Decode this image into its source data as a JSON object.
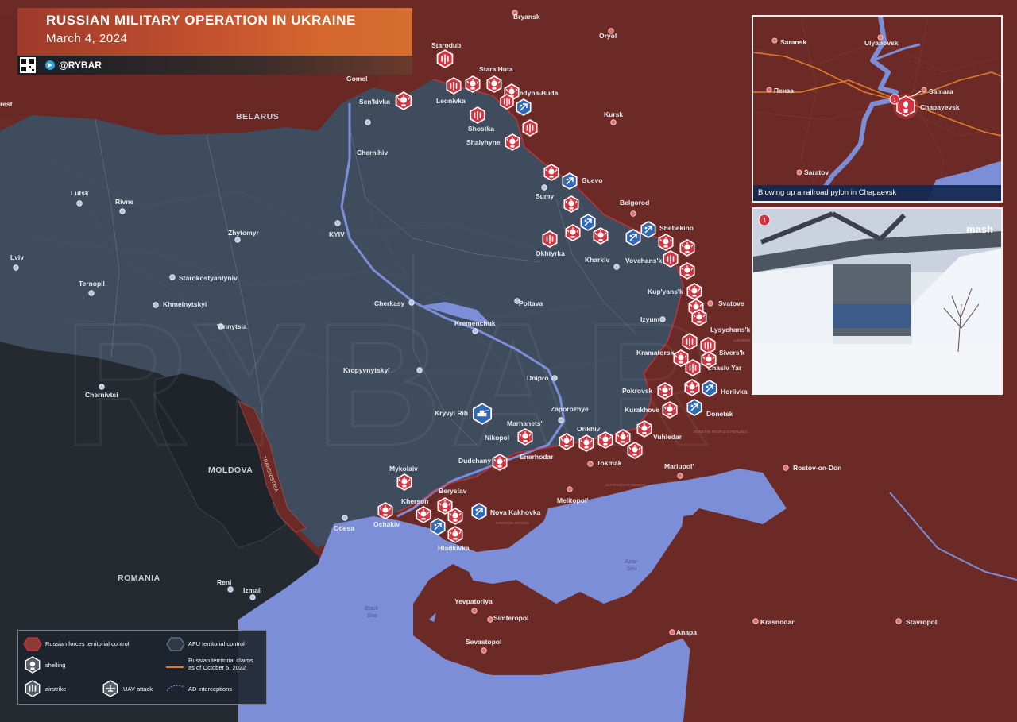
{
  "header": {
    "title": "RUSSIAN MILITARY OPERATION IN UKRAINE",
    "date": "March 4, 2024",
    "handle": "@RYBAR"
  },
  "colors": {
    "russia_control": "#6b2a25",
    "afu_control": "#3e4c5e",
    "sea": "#7d8ed8",
    "accent": "#c94f2e",
    "marker_red": "#d4333f",
    "marker_blue": "#2f6ab8"
  },
  "countries": {
    "belarus": "BELARUS",
    "moldova": "MOLDOVA",
    "romania": "ROMANIA",
    "transnistria": "TRANSNISTRIA"
  },
  "seas": {
    "black_sea": "Black\nSea",
    "azov_sea": "Azov\nSea"
  },
  "cities": {
    "bryansk": "Bryansk",
    "oryol": "Oryol",
    "starodub": "Starodub",
    "stara_huta": "Stara Huta",
    "gomel": "Gomel",
    "brest": "rest",
    "senkivka": "Sen'kivka",
    "leonivka": "Leonivka",
    "seredyna_buda": "Seredyna-Buda",
    "shostka": "Shostka",
    "shalyhyne": "Shalyhyne",
    "kursk": "Kursk",
    "chernihiv": "Chernihiv",
    "guevo": "Guevo",
    "sumy": "Sumy",
    "belgorod": "Belgorod",
    "shebekino": "Shebekino",
    "okhtyrka": "Okhtyrka",
    "kharkiv": "Kharkiv",
    "vovchansk": "Vovchans'k",
    "lutsk": "Lutsk",
    "rivne": "Rivne",
    "zhytomyr": "Zhytomyr",
    "kyiv": "KYIV",
    "lviv": "Lviv",
    "starokostyantyniv": "Starokostyantyniv",
    "ternopil": "Ternopil",
    "khmelnytskyi": "Khmelnytskyi",
    "vinnytsia": "Vinnytsia",
    "cherkasy": "Cherkasy",
    "poltava": "Poltava",
    "kupyansk": "Kup'yans'k",
    "svatove": "Svatove",
    "izyum": "Izyum",
    "lysychansk": "Lysychans'k",
    "kremenchuk": "Kremenchuk",
    "kramatorsk": "Kramatorsk",
    "siversk": "Sivers'k",
    "chasiv_yar": "Chasiv Yar",
    "chernivtsi": "Chernivtsi",
    "kropyvnytskyi": "Kropyvnytskyi",
    "dnipro": "Dnipro",
    "pokrovsk": "Pokrovsk",
    "horlivka": "Horlivka",
    "kurakhove": "Kurakhove",
    "donetsk": "Donetsk",
    "kryvyi_rih": "Kryvyi Rih",
    "zaporozhye": "Zaporozhye",
    "marhanets": "Marhanets'",
    "orikhiv": "Orikhiv",
    "vuhledar": "Vuhledar",
    "nikopol": "Nikopol",
    "enerhodar": "Enerhodar",
    "tokmak": "Tokmak",
    "mariupol": "Mariupol'",
    "rostov": "Rostov-on-Don",
    "dudchany": "Dudchany",
    "mykolaiv": "Mykolaiv",
    "beryslav": "Beryslav",
    "kherson": "Kherson",
    "nova_kakhovka": "Nova Kakhovka",
    "melitopol": "Melitopol'",
    "ochakiv": "Ochakiv",
    "odesa": "Odesa",
    "hladkivka": "Hladkivka",
    "reni": "Reni",
    "izmail": "Izmail",
    "yevpatoriya": "Yevpatoriya",
    "simferopol": "Simferopol",
    "sevastopol": "Sevastopol",
    "anapa": "Anapa",
    "krasnodar": "Krasnodar",
    "stavropol": "Stavropol"
  },
  "regions": {
    "luhansk_pr": "LUGANSK\nPEOPLE'S\nREPUBLIC",
    "donetsk_pr": "DONETSK\nPEOPLE'S\nREPUBLIC",
    "zaporozhye_region": "ZAPOROZHYE\nREGION",
    "kherson_region": "KHERSON\nREGION"
  },
  "inset_map": {
    "cities": {
      "saransk": "Saransk",
      "ulyanovsk": "Ulyanovsk",
      "penza": "Пенза",
      "samara": "Samara",
      "chapayevsk": "Chapayevsk",
      "saratov": "Saratov"
    },
    "badge_number": "1",
    "caption": "Blowing up a railroad pylon in Chapaevsk"
  },
  "inset_photo": {
    "badge_number": "1",
    "watermark": "mash"
  },
  "legend": {
    "russian_control": "Russian forces territorial control",
    "afu_control": "AFU territorial control",
    "shelling": "shelling",
    "claims": "Russian territorial claims\nas of October 5, 2022",
    "airstrike": "airstrike",
    "uav": "UAV attack",
    "ad": "AD interceptions"
  },
  "markers": [
    {
      "type": "shelling"
    },
    {
      "type": "airstrike"
    }
  ]
}
